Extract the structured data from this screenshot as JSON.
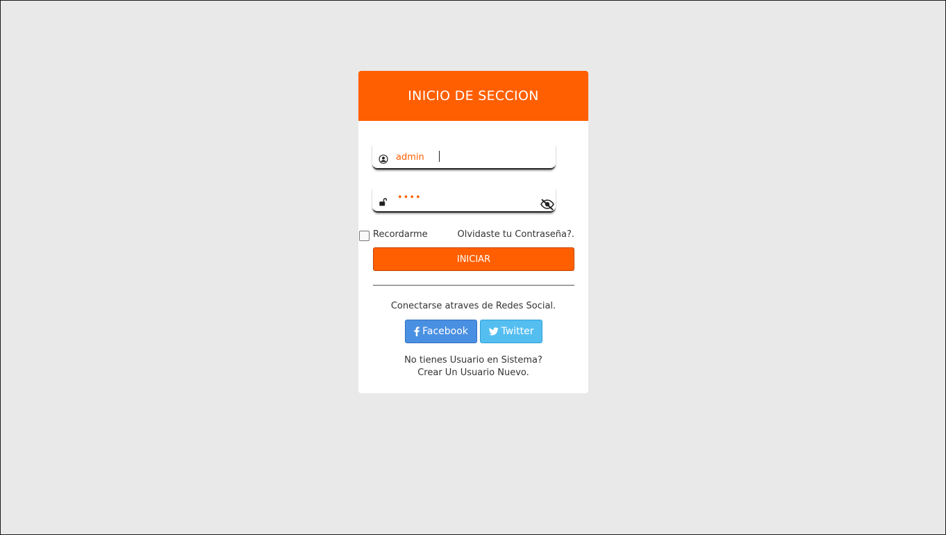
{
  "colors": {
    "accent": "#ff5f00",
    "background": "#e9e9e9",
    "facebook": "#4a90e2",
    "twitter": "#55bef0"
  },
  "login": {
    "title": "INICIO DE SECCION",
    "username": {
      "value": "admin",
      "icon": "user-circle-icon"
    },
    "password": {
      "masked_value": "••••",
      "icon": "unlock-icon",
      "toggle_icon": "eye-slash-icon"
    },
    "remember_label": "Recordarme",
    "remember_checked": false,
    "forgot_label": "Olvidaste tu Contraseña?.",
    "submit_label": "INICIAR",
    "social_prompt": "Conectarse atraves de Redes Social.",
    "social_buttons": [
      {
        "label": "Facebook",
        "icon": "facebook-icon"
      },
      {
        "label": "Twitter",
        "icon": "twitter-icon"
      }
    ],
    "signup_question": "No tienes Usuario en Sistema?",
    "signup_link": "Crear Un Usuario Nuevo."
  }
}
